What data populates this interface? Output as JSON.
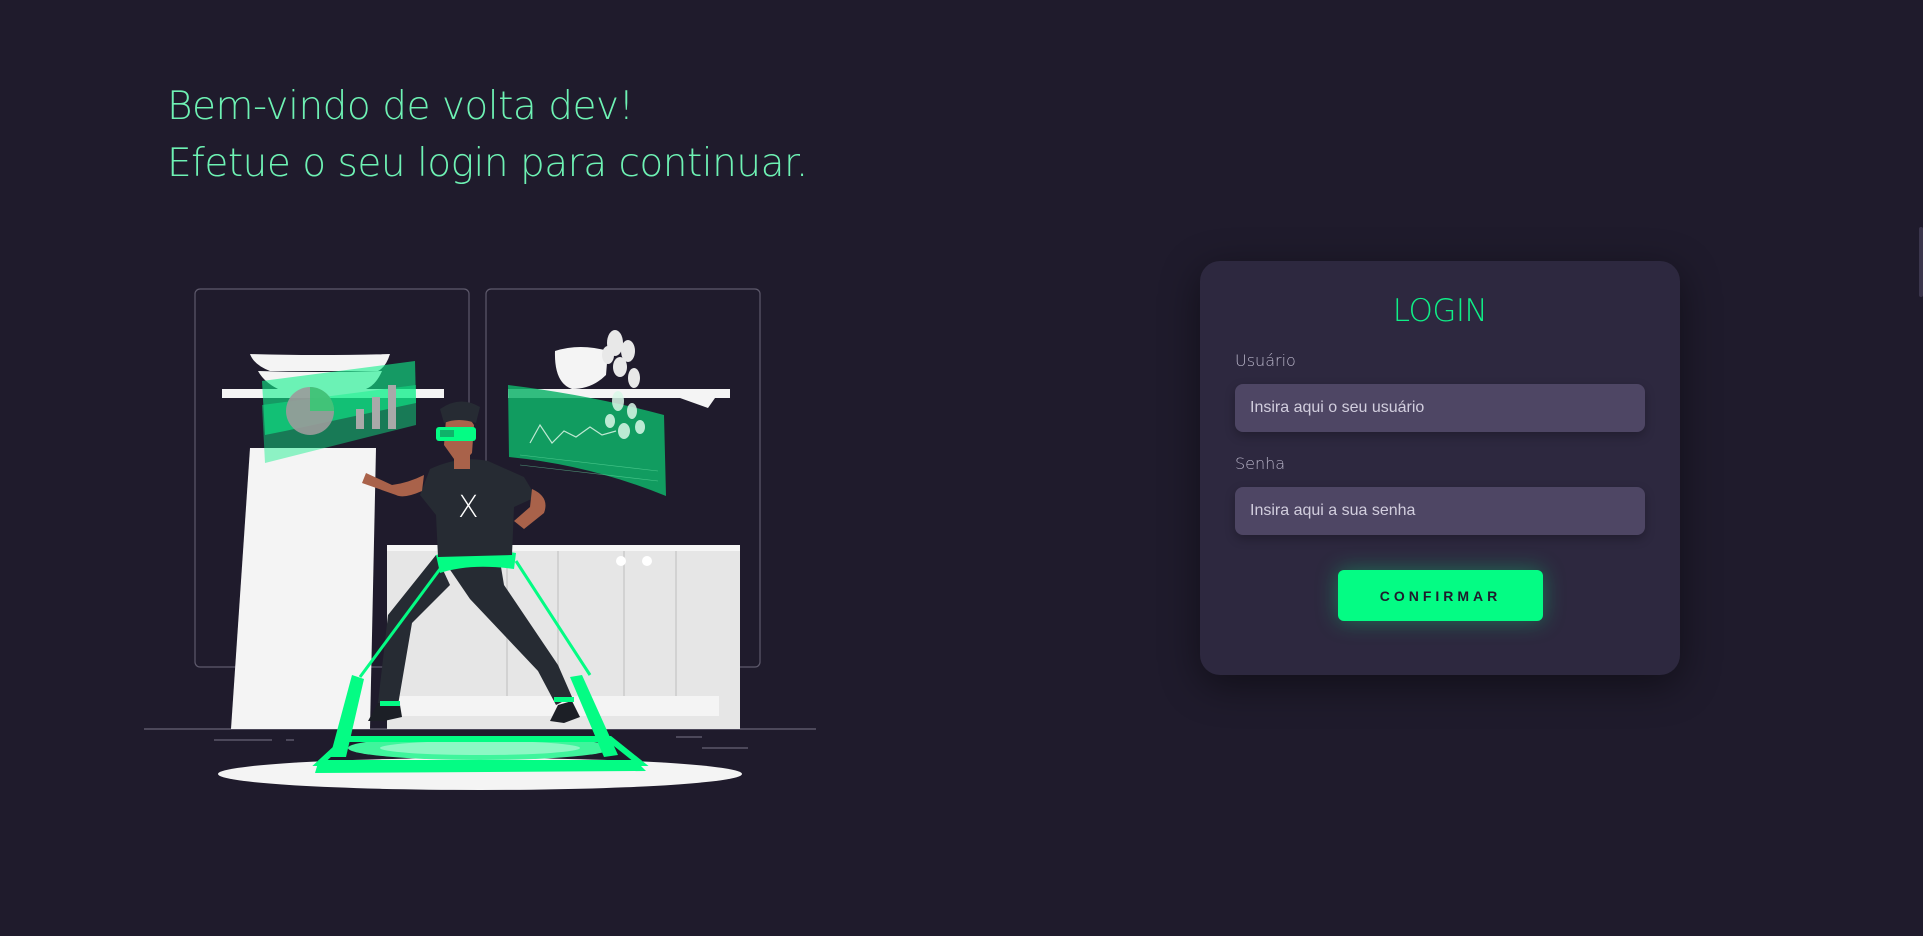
{
  "colors": {
    "background": "#1f1b2c",
    "accent": "#0fef87",
    "headline": "#6ef2b4",
    "card": "#2d283f",
    "input": "#4e4664",
    "button": "#04fc84"
  },
  "hero": {
    "line1": "Bem-vindo de volta dev!",
    "line2": "Efetue o seu login para continuar."
  },
  "illustration": {
    "icon": "vr-developer-illustration",
    "chest_mark": "X"
  },
  "login": {
    "title": "LOGIN",
    "username_label": "Usuário",
    "username_placeholder": "Insira aqui o seu usuário",
    "password_label": "Senha",
    "password_placeholder": "Insira aqui a sua senha",
    "submit_label": "CONFIRMAR"
  }
}
